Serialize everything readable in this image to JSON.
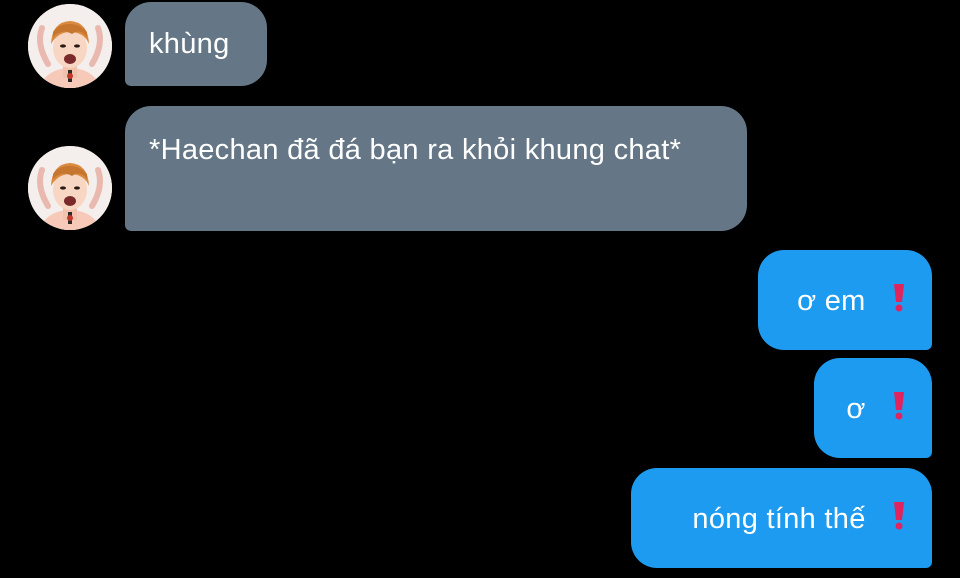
{
  "conversation": {
    "messages": [
      {
        "direction": "incoming",
        "text": "khùng",
        "sender_avatar": "avatar-icon"
      },
      {
        "direction": "incoming",
        "text": "*Haechan đã đá bạn ra khỏi khung chat*",
        "sender_avatar": "avatar-icon"
      },
      {
        "direction": "outgoing",
        "text": "ơ em",
        "emoji": "exclamation-icon"
      },
      {
        "direction": "outgoing",
        "text": "ơ",
        "emoji": "exclamation-icon"
      },
      {
        "direction": "outgoing",
        "text": "nóng tính thế",
        "emoji": "exclamation-icon"
      }
    ]
  },
  "colors": {
    "background": "#000000",
    "incoming_bubble": "#657786",
    "outgoing_bubble": "#1d9bf0",
    "text": "#ffffff",
    "exclamation": "#e0245e"
  }
}
